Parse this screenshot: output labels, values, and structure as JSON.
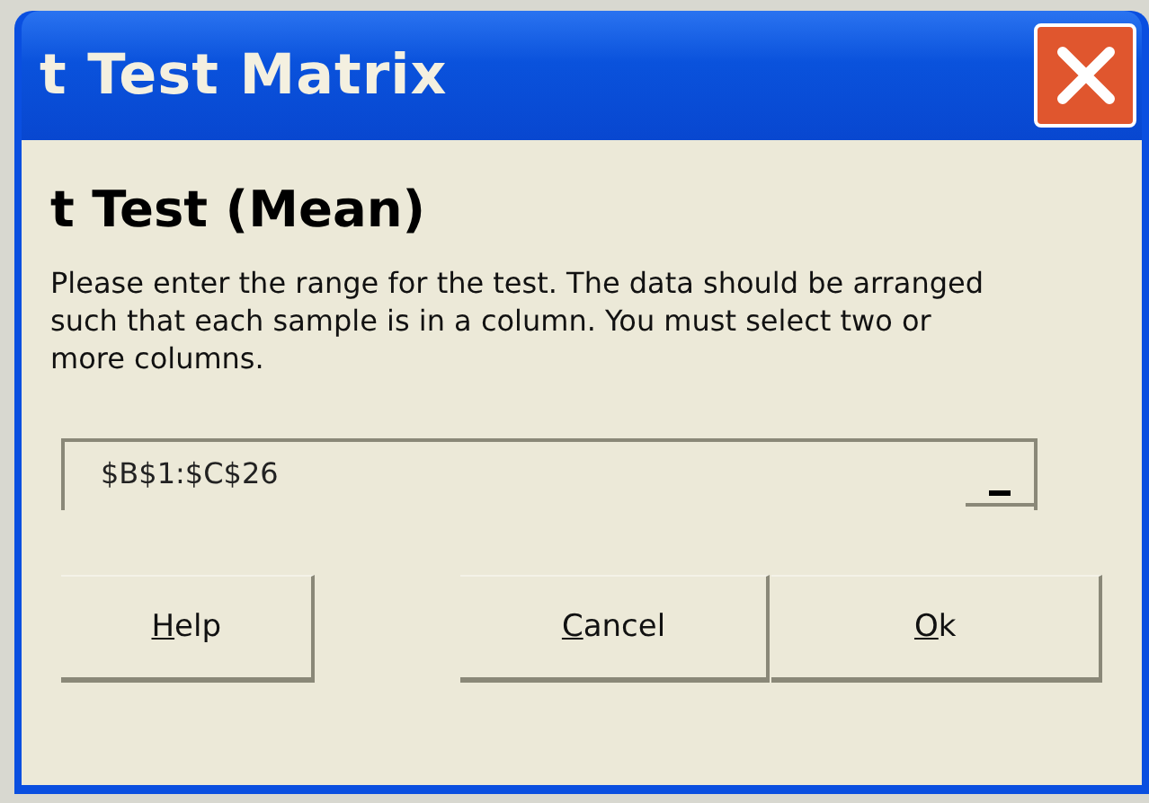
{
  "window": {
    "title": "t Test Matrix"
  },
  "heading": "t Test (Mean)",
  "instructions": "Please enter the range for the test. The data should be arranged such that each sample is in a column. You must select two or more columns.",
  "range_field": {
    "value": "$B$1:$C$26"
  },
  "buttons": [
    {
      "label": "Help"
    },
    {
      "label": "Cancel"
    },
    {
      "label": "Ok"
    }
  ]
}
